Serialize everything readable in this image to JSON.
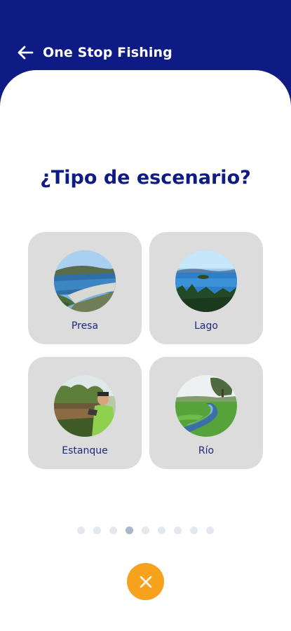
{
  "header": {
    "title": "One Stop Fishing",
    "back_icon": "arrow-left-icon",
    "color": "#0f1b84"
  },
  "question": "¿Tipo de escenario?",
  "options": [
    {
      "label": "Presa",
      "image": "dam-photo"
    },
    {
      "label": "Lago",
      "image": "lake-photo"
    },
    {
      "label": "Estanque",
      "image": "pond-photo"
    },
    {
      "label": "Río",
      "image": "river-photo"
    }
  ],
  "pagination": {
    "total": 9,
    "current": 4
  },
  "close_button": {
    "icon": "close-icon",
    "color": "#f6a21c"
  }
}
